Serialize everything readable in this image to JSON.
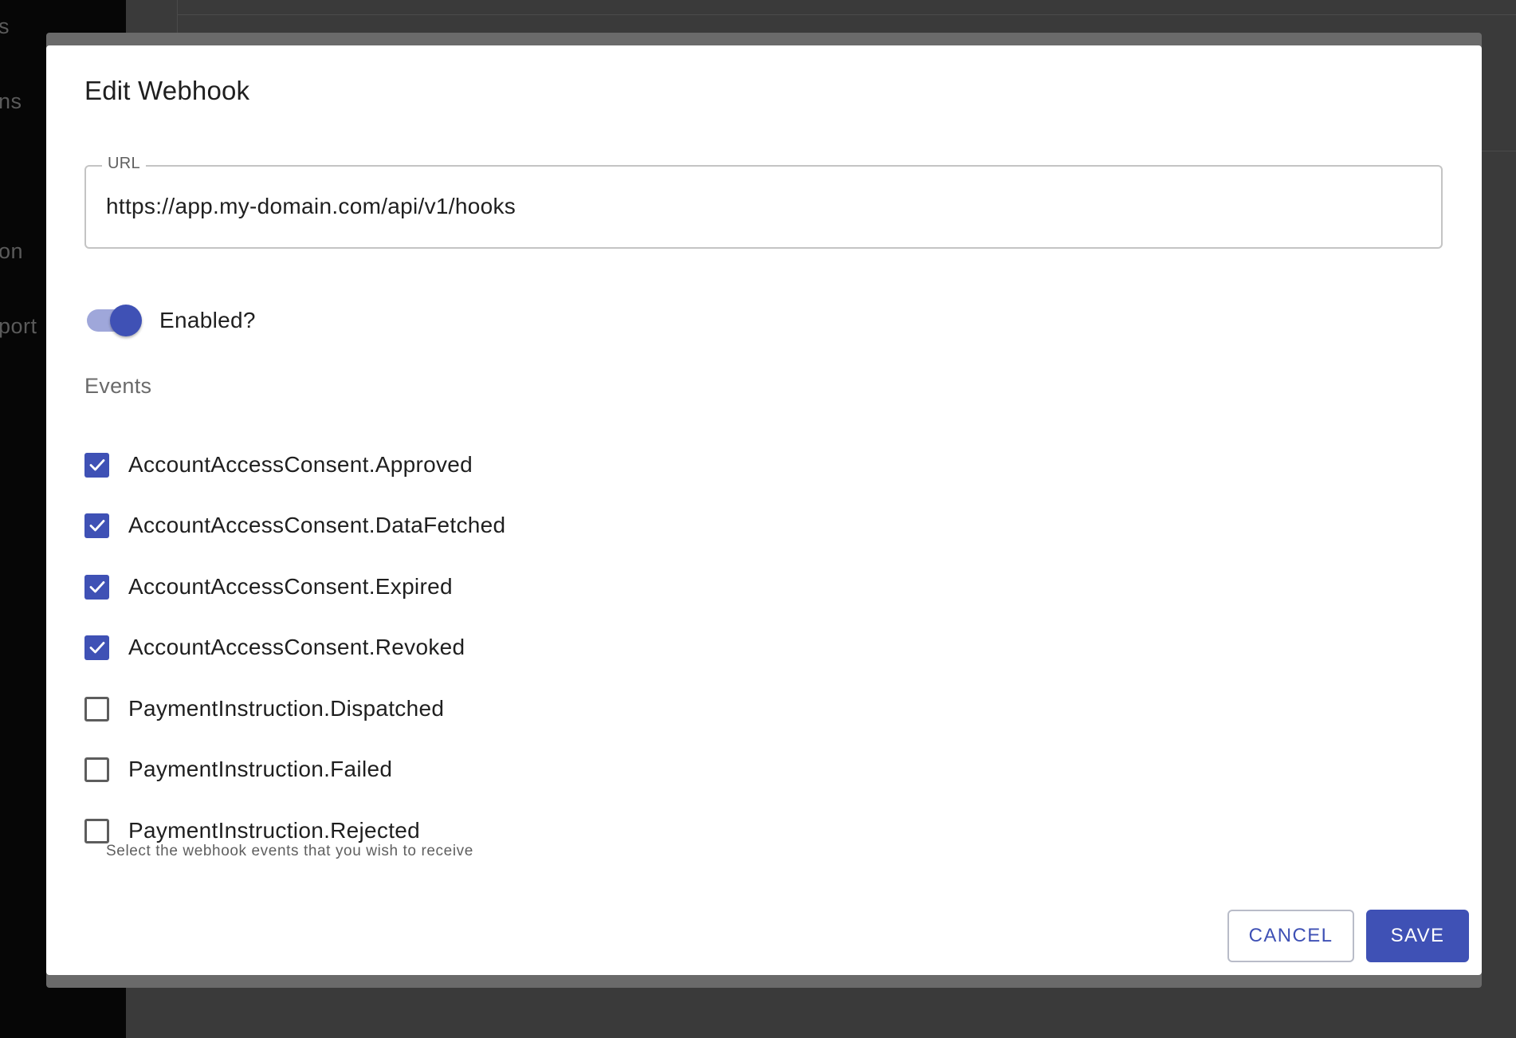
{
  "background": {
    "sidebar_fragments": [
      "s",
      "ns",
      "on",
      "port"
    ]
  },
  "dialog": {
    "title": "Edit Webhook",
    "url": {
      "label": "URL",
      "value": "https://app.my-domain.com/api/v1/hooks"
    },
    "enabled_toggle": {
      "label": "Enabled?",
      "on": true
    },
    "events": {
      "heading": "Events",
      "items": [
        {
          "label": "AccountAccessConsent.Approved",
          "checked": true
        },
        {
          "label": "AccountAccessConsent.DataFetched",
          "checked": true
        },
        {
          "label": "AccountAccessConsent.Expired",
          "checked": true
        },
        {
          "label": "AccountAccessConsent.Revoked",
          "checked": true
        },
        {
          "label": "PaymentInstruction.Dispatched",
          "checked": false
        },
        {
          "label": "PaymentInstruction.Failed",
          "checked": false
        },
        {
          "label": "PaymentInstruction.Rejected",
          "checked": false
        }
      ],
      "helper_text": "Select the webhook events that you wish to receive"
    },
    "actions": {
      "cancel_label": "CANCEL",
      "save_label": "SAVE"
    }
  },
  "colors": {
    "primary": "#3f51b5",
    "toggle_track": "#9fa7da",
    "backdrop": "#3d3d3d"
  }
}
